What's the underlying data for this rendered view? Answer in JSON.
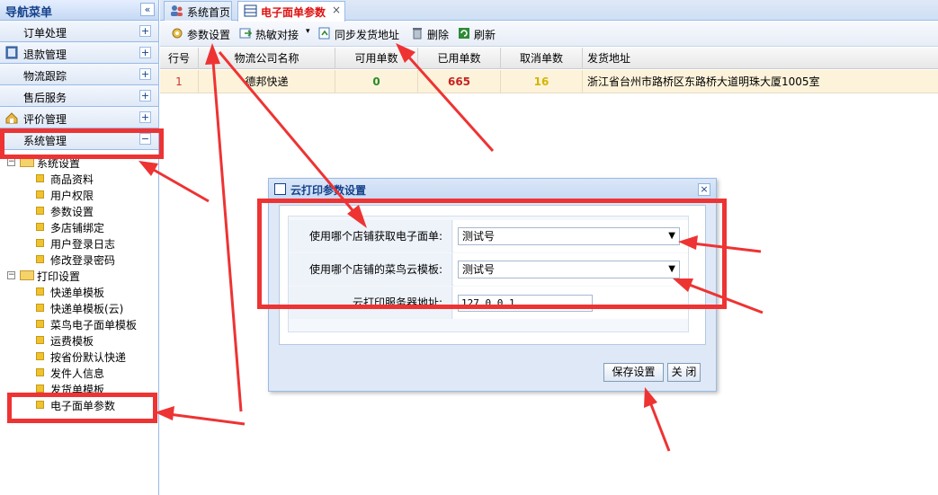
{
  "nav": {
    "title": "导航菜单",
    "collapse_symbol": "«",
    "menu": [
      {
        "label": "订单处理",
        "toggle": "+"
      },
      {
        "label": "退款管理",
        "toggle": "+"
      },
      {
        "label": "物流跟踪",
        "toggle": "+"
      },
      {
        "label": "售后服务",
        "toggle": "+"
      },
      {
        "label": "评价管理",
        "toggle": "+"
      },
      {
        "label": "系统管理",
        "toggle": "−"
      }
    ],
    "tree": {
      "group1": {
        "label": "系统设置",
        "items": [
          "商品资料",
          "用户权限",
          "参数设置",
          "多店铺绑定",
          "用户登录日志",
          "修改登录密码"
        ]
      },
      "group2": {
        "label": "打印设置",
        "items": [
          "快递单模板",
          "快递单模板(云)",
          "菜鸟电子面单模板",
          "运费模板",
          "按省份默认快递",
          "发件人信息",
          "发货单模板",
          "电子面单参数"
        ]
      }
    }
  },
  "tabs": [
    {
      "label": "系统首页"
    },
    {
      "label": "电子面单参数",
      "close": "×"
    }
  ],
  "toolbar": {
    "params": "参数设置",
    "hotkey": "热敏对接",
    "sync": "同步发货地址",
    "delete": "删除",
    "refresh": "刷新"
  },
  "grid": {
    "columns": [
      "行号",
      "物流公司名称",
      "可用单数",
      "已用单数",
      "取消单数",
      "发货地址"
    ],
    "rows": [
      {
        "no": "1",
        "company": "德邦快递",
        "available": "0",
        "used": "665",
        "cancelled": "16",
        "address": "浙江省台州市路桥区东路桥大道明珠大厦1005室"
      }
    ]
  },
  "dialog": {
    "title": "云打印参数设置",
    "close": "×",
    "fields": {
      "shop_label": "使用哪个店铺获取电子面单:",
      "shop_value": "测试号",
      "template_label": "使用哪个店铺的菜鸟云模板:",
      "template_value": "测试号",
      "server_label": "云打印服务器地址:",
      "server_value": "127.0.0.1"
    },
    "save": "保存设置",
    "close_btn": "关 闭"
  },
  "colors": {
    "highlight": "#ee3333",
    "accent": "#15428b",
    "row": "#fdf3da"
  }
}
